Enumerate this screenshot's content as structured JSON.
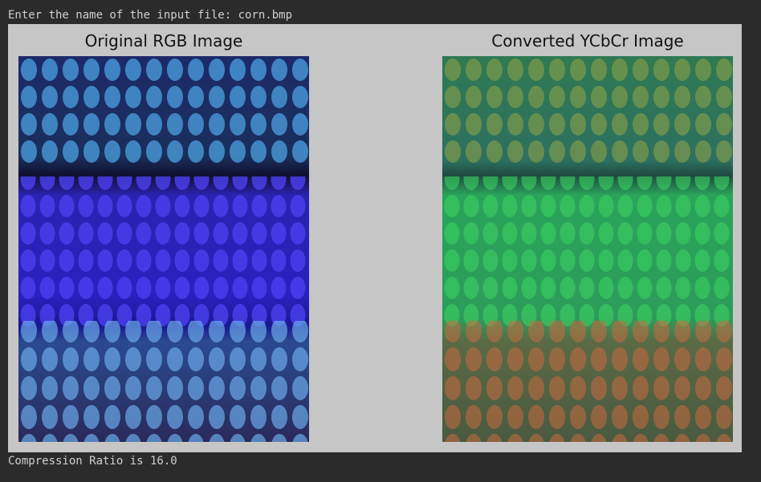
{
  "console": {
    "prompt_text": "Enter the name of the input file: corn.bmp",
    "result_text": "Compression Ratio is 16.0"
  },
  "figure": {
    "left_title": "Original RGB Image",
    "right_title": "Converted YCbCr Image"
  }
}
